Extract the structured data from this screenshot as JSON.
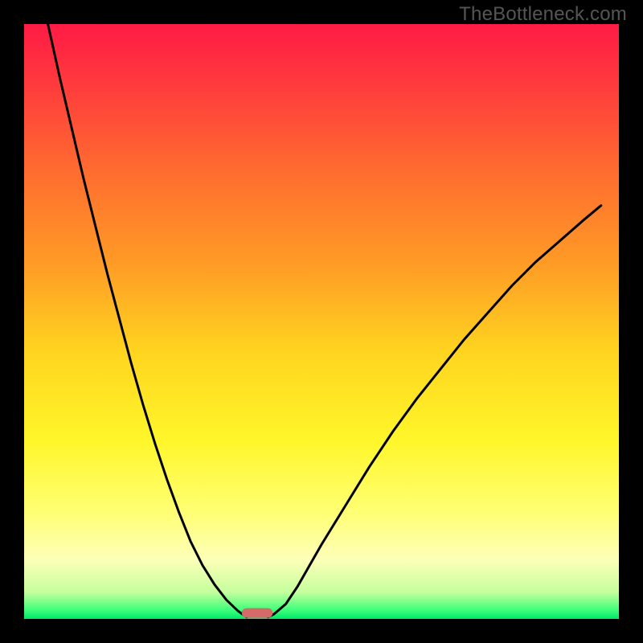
{
  "watermark": "TheBottleneck.com",
  "chart_data": {
    "type": "line",
    "title": "",
    "xlabel": "",
    "ylabel": "",
    "x_range": [
      0,
      100
    ],
    "y_range": [
      0,
      100
    ],
    "gradient_stops": [
      {
        "offset": 0.0,
        "color": "#ff1b45"
      },
      {
        "offset": 0.1,
        "color": "#ff3a3d"
      },
      {
        "offset": 0.25,
        "color": "#ff6d2f"
      },
      {
        "offset": 0.4,
        "color": "#ff9a26"
      },
      {
        "offset": 0.55,
        "color": "#ffd41f"
      },
      {
        "offset": 0.7,
        "color": "#fff62a"
      },
      {
        "offset": 0.82,
        "color": "#ffff73"
      },
      {
        "offset": 0.9,
        "color": "#fdffb8"
      },
      {
        "offset": 0.955,
        "color": "#c5ff9d"
      },
      {
        "offset": 0.985,
        "color": "#3eff7a"
      },
      {
        "offset": 1.0,
        "color": "#00e86b"
      }
    ],
    "series": [
      {
        "name": "left-curve",
        "x": [
          4.0,
          6.0,
          8.0,
          10.0,
          12.0,
          14.0,
          16.0,
          18.0,
          20.0,
          22.0,
          24.0,
          26.0,
          28.0,
          30.0,
          32.0,
          34.0,
          36.0,
          37.4
        ],
        "y": [
          100.0,
          91.0,
          82.5,
          74.0,
          66.0,
          58.0,
          50.5,
          43.0,
          36.0,
          29.5,
          23.5,
          18.0,
          13.0,
          9.0,
          5.8,
          3.2,
          1.3,
          0.3
        ]
      },
      {
        "name": "right-curve",
        "x": [
          41.0,
          42.0,
          44.0,
          46.0,
          48.0,
          50.0,
          54.0,
          58.0,
          62.0,
          66.0,
          70.0,
          74.0,
          78.0,
          82.0,
          86.0,
          90.0,
          94.0,
          97.0
        ],
        "y": [
          0.3,
          0.8,
          2.5,
          5.5,
          9.0,
          12.5,
          19.0,
          25.5,
          31.5,
          37.0,
          42.0,
          47.0,
          51.5,
          56.0,
          60.0,
          63.5,
          67.0,
          69.5
        ]
      }
    ],
    "minimum_marker": {
      "x_center": 39.2,
      "x_halfwidth": 2.6,
      "y": 1.0,
      "color": "#d46a6a",
      "shape": "rounded-bar"
    }
  }
}
